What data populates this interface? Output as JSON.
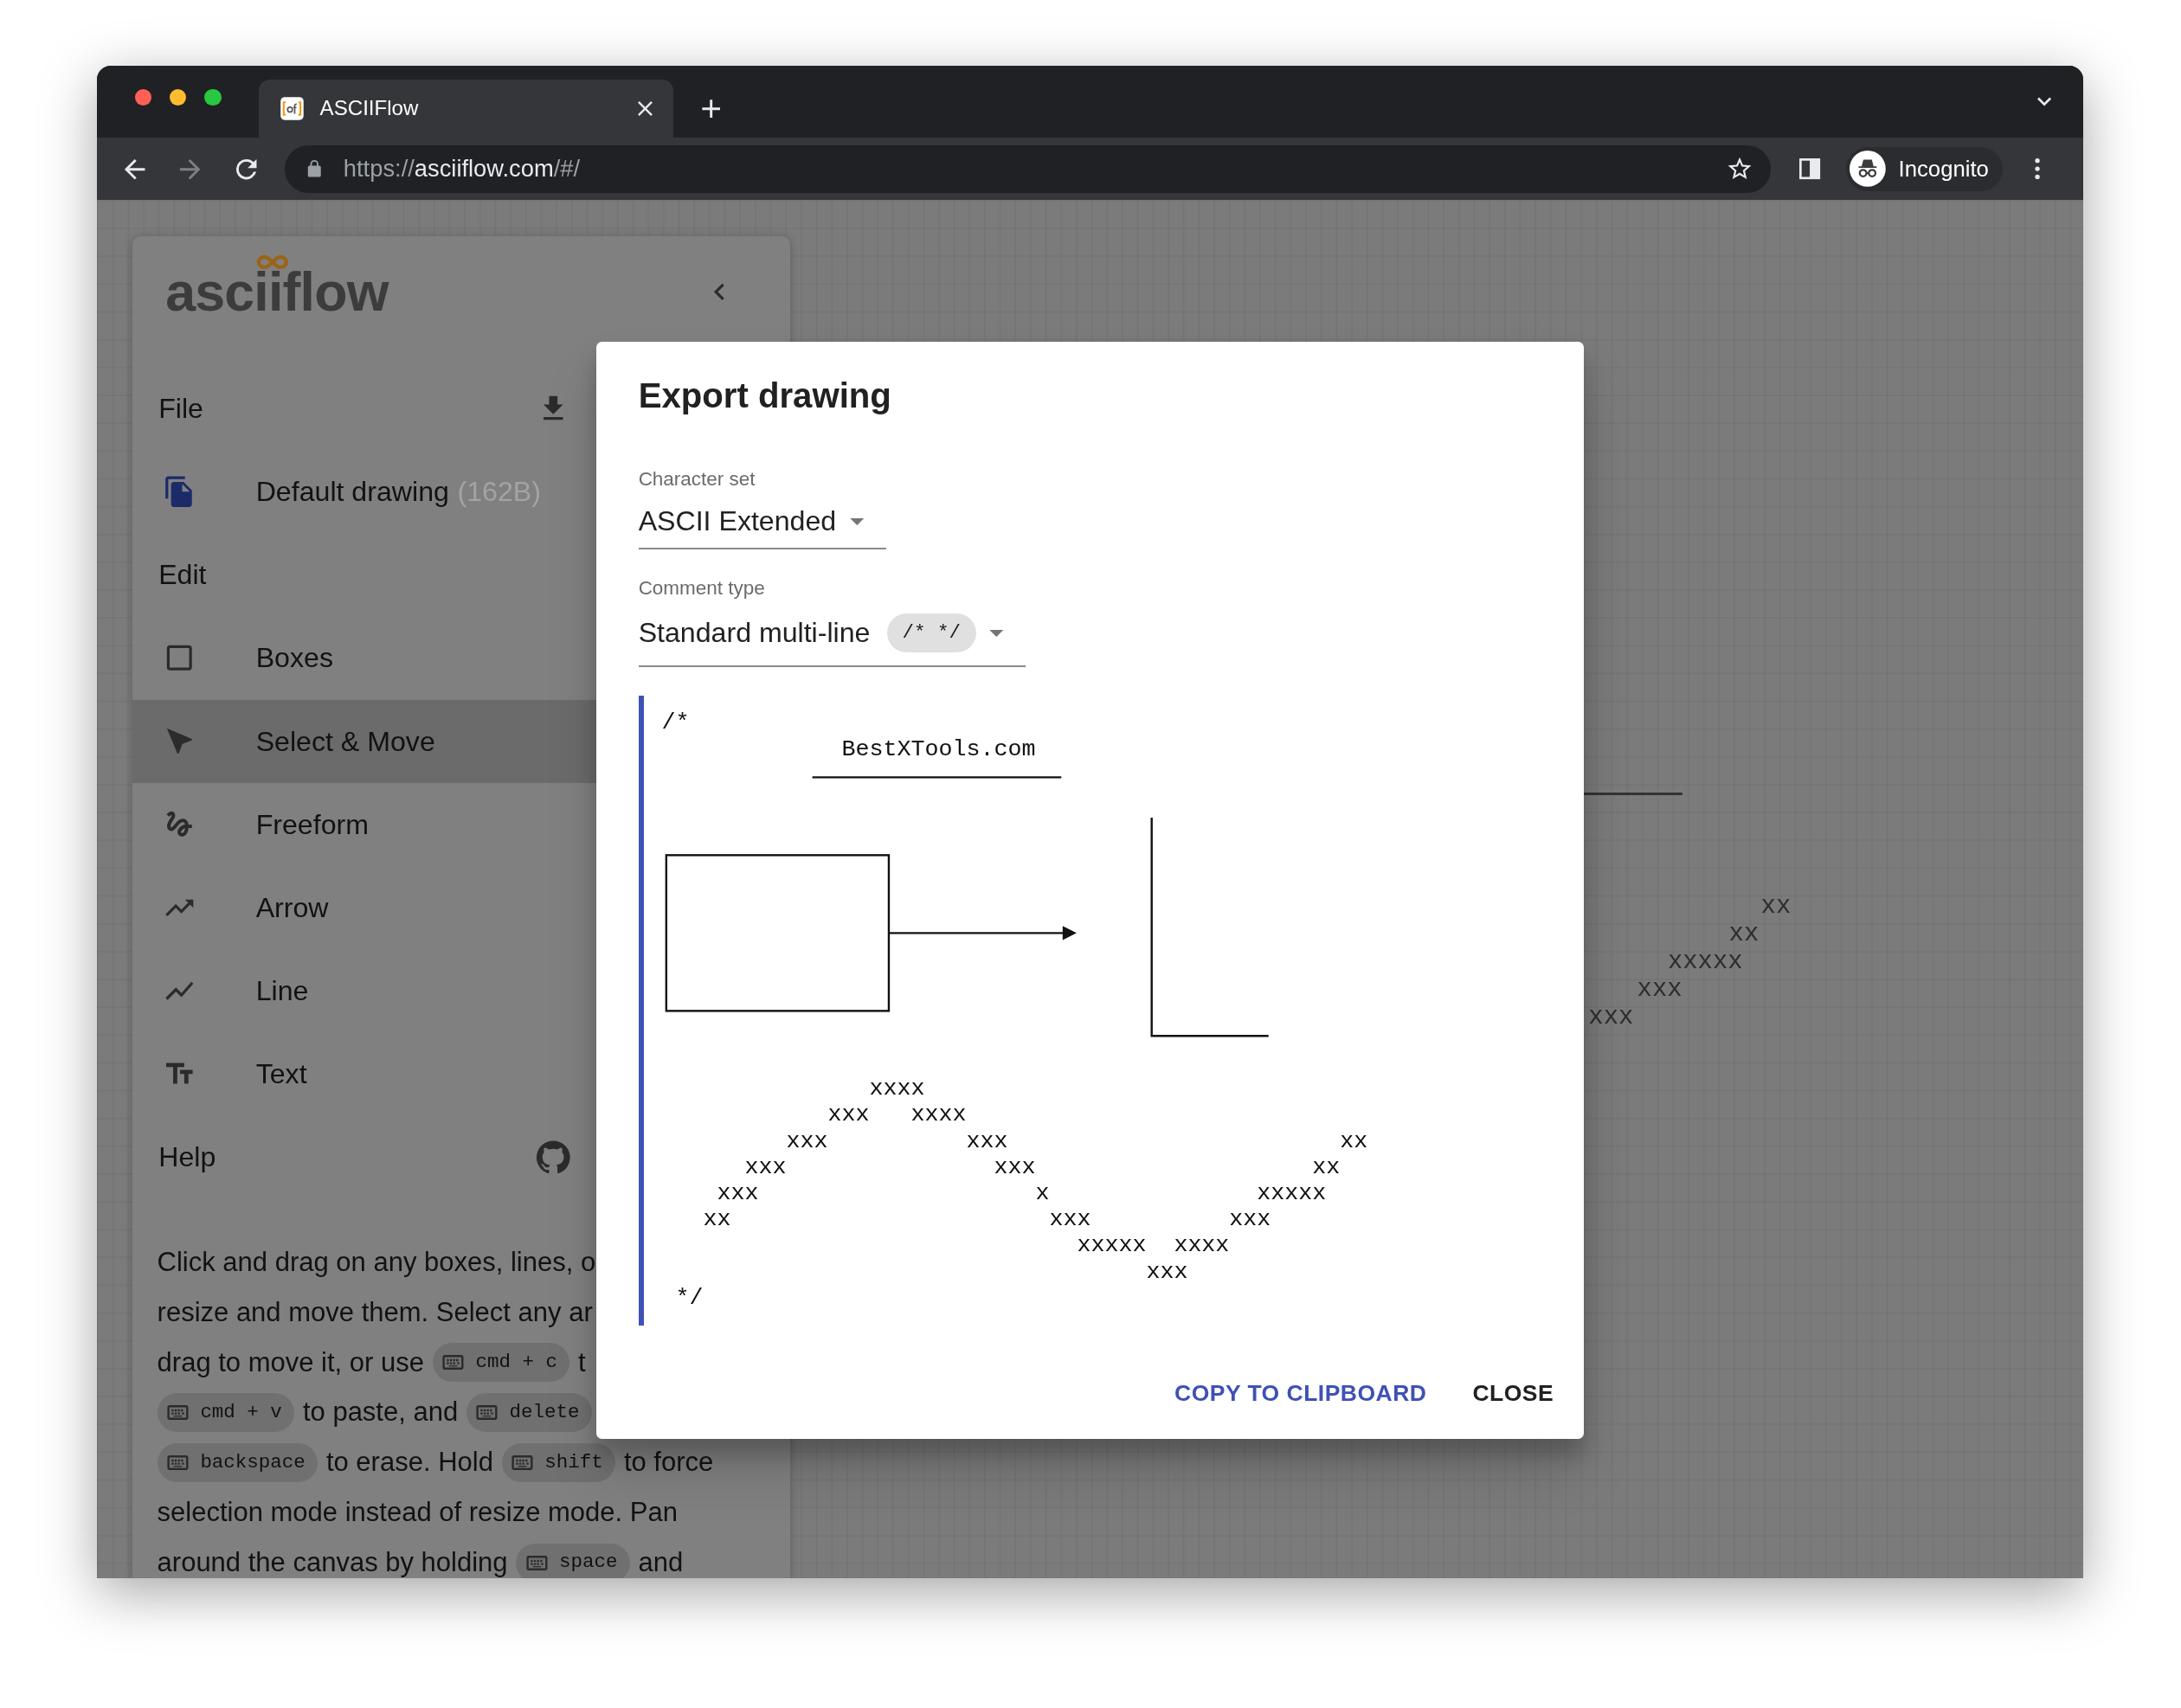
{
  "browser": {
    "tab": {
      "title": "ASCIIFlow"
    },
    "address_bar": {
      "scheme": "https://",
      "host": "asciiflow.com",
      "path": "/#/"
    },
    "profile": {
      "label": "Incognito"
    }
  },
  "sidebar": {
    "logo": "asciiflow",
    "items": [
      {
        "kind": "header",
        "label": "File"
      },
      {
        "kind": "drawing",
        "label": "Default drawing",
        "size": "(162B)"
      },
      {
        "kind": "header",
        "label": "Edit"
      },
      {
        "kind": "tool",
        "label": "Boxes",
        "selected": false
      },
      {
        "kind": "tool",
        "label": "Select & Move",
        "selected": true
      },
      {
        "kind": "tool",
        "label": "Freeform",
        "selected": false
      },
      {
        "kind": "tool",
        "label": "Arrow",
        "selected": false
      },
      {
        "kind": "tool",
        "label": "Line",
        "selected": false
      },
      {
        "kind": "tool",
        "label": "Text",
        "selected": false
      },
      {
        "kind": "header",
        "label": "Help"
      }
    ],
    "help_lines": [
      [
        {
          "kind": "text",
          "text": "Click and drag on any boxes, lines, o"
        }
      ],
      [
        {
          "kind": "text",
          "text": "resize and move them. Select any ar"
        }
      ],
      [
        {
          "kind": "text",
          "text": "drag to move it, or use"
        },
        {
          "kind": "key",
          "text": "cmd + c"
        },
        {
          "kind": "text",
          "text": "t"
        }
      ],
      [
        {
          "kind": "key",
          "text": "cmd + v"
        },
        {
          "kind": "text",
          "text": "to paste, and"
        },
        {
          "kind": "key",
          "text": "delete"
        }
      ],
      [
        {
          "kind": "key",
          "text": "backspace"
        },
        {
          "kind": "text",
          "text": "to erase. Hold"
        },
        {
          "kind": "key",
          "text": "shift"
        },
        {
          "kind": "text",
          "text": "to force"
        }
      ],
      [
        {
          "kind": "text",
          "text": "selection mode instead of resize mode. Pan"
        }
      ],
      [
        {
          "kind": "text",
          "text": "around the canvas by holding"
        },
        {
          "kind": "key",
          "text": "space"
        },
        {
          "kind": "text",
          "text": "and"
        }
      ]
    ]
  },
  "canvas": {
    "marks": [
      "xx",
      "xx",
      "xxxxx",
      "xxx",
      "xxx"
    ]
  },
  "dialog": {
    "title": "Export drawing",
    "fields": [
      {
        "label": "Character set",
        "value": "ASCII Extended"
      },
      {
        "label": "Comment type",
        "value": "Standard multi-line",
        "chip": "/* */"
      }
    ],
    "preview": {
      "comment_open": "/*",
      "title": "BestXTools.com",
      "rows": [
        "               xxxx",
        "            xxx   xxxx",
        "         xxx          xxx                        xx",
        "      xxx               xxx                    xx",
        "    xxx                    x               xxxxx",
        "   xx                       xxx          xxx",
        "                              xxxxx  xxxx",
        "                                   xxx"
      ],
      "comment_close": "*/"
    },
    "buttons": [
      {
        "kind": "primary",
        "label": "COPY TO CLIPBOARD"
      },
      {
        "kind": "plain",
        "label": "CLOSE"
      }
    ]
  }
}
